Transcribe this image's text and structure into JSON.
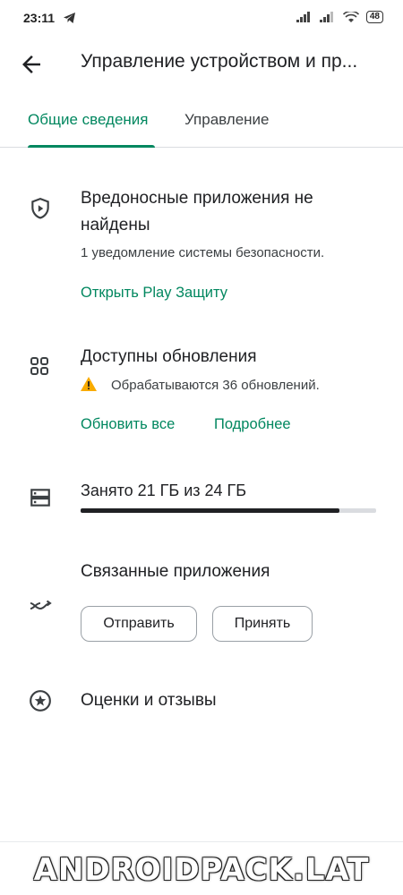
{
  "status_bar": {
    "time": "23:11",
    "battery": "48"
  },
  "header": {
    "title": "Управление устройством и пр..."
  },
  "tabs": [
    {
      "label": "Общие сведения",
      "active": true
    },
    {
      "label": "Управление",
      "active": false
    }
  ],
  "security": {
    "icon": "shield-play-icon",
    "title_line1": "Вредоносные приложения не",
    "title_line2": "найдены",
    "subtitle": "1 уведомление системы безопасности.",
    "link": "Открыть Play Защиту"
  },
  "updates": {
    "icon": "apps-grid-icon",
    "title": "Доступны обновления",
    "warning_icon": "warning-icon",
    "status": "Обрабатываются 36 обновлений.",
    "update_all": "Обновить все",
    "details": "Подробнее"
  },
  "storage": {
    "icon": "storage-icon",
    "title": "Занято 21 ГБ из 24 ГБ",
    "used_fraction": 0.875
  },
  "linked_apps": {
    "icon": "share-arrows-icon",
    "title": "Связанные приложения",
    "send": "Отправить",
    "receive": "Принять"
  },
  "ratings": {
    "icon": "star-circle-icon",
    "title": "Оценки и отзывы"
  },
  "watermark": "ANDROIDPACK.LAT",
  "colors": {
    "accent": "#01875f",
    "text": "#202124",
    "warning": "#f9ab00"
  }
}
